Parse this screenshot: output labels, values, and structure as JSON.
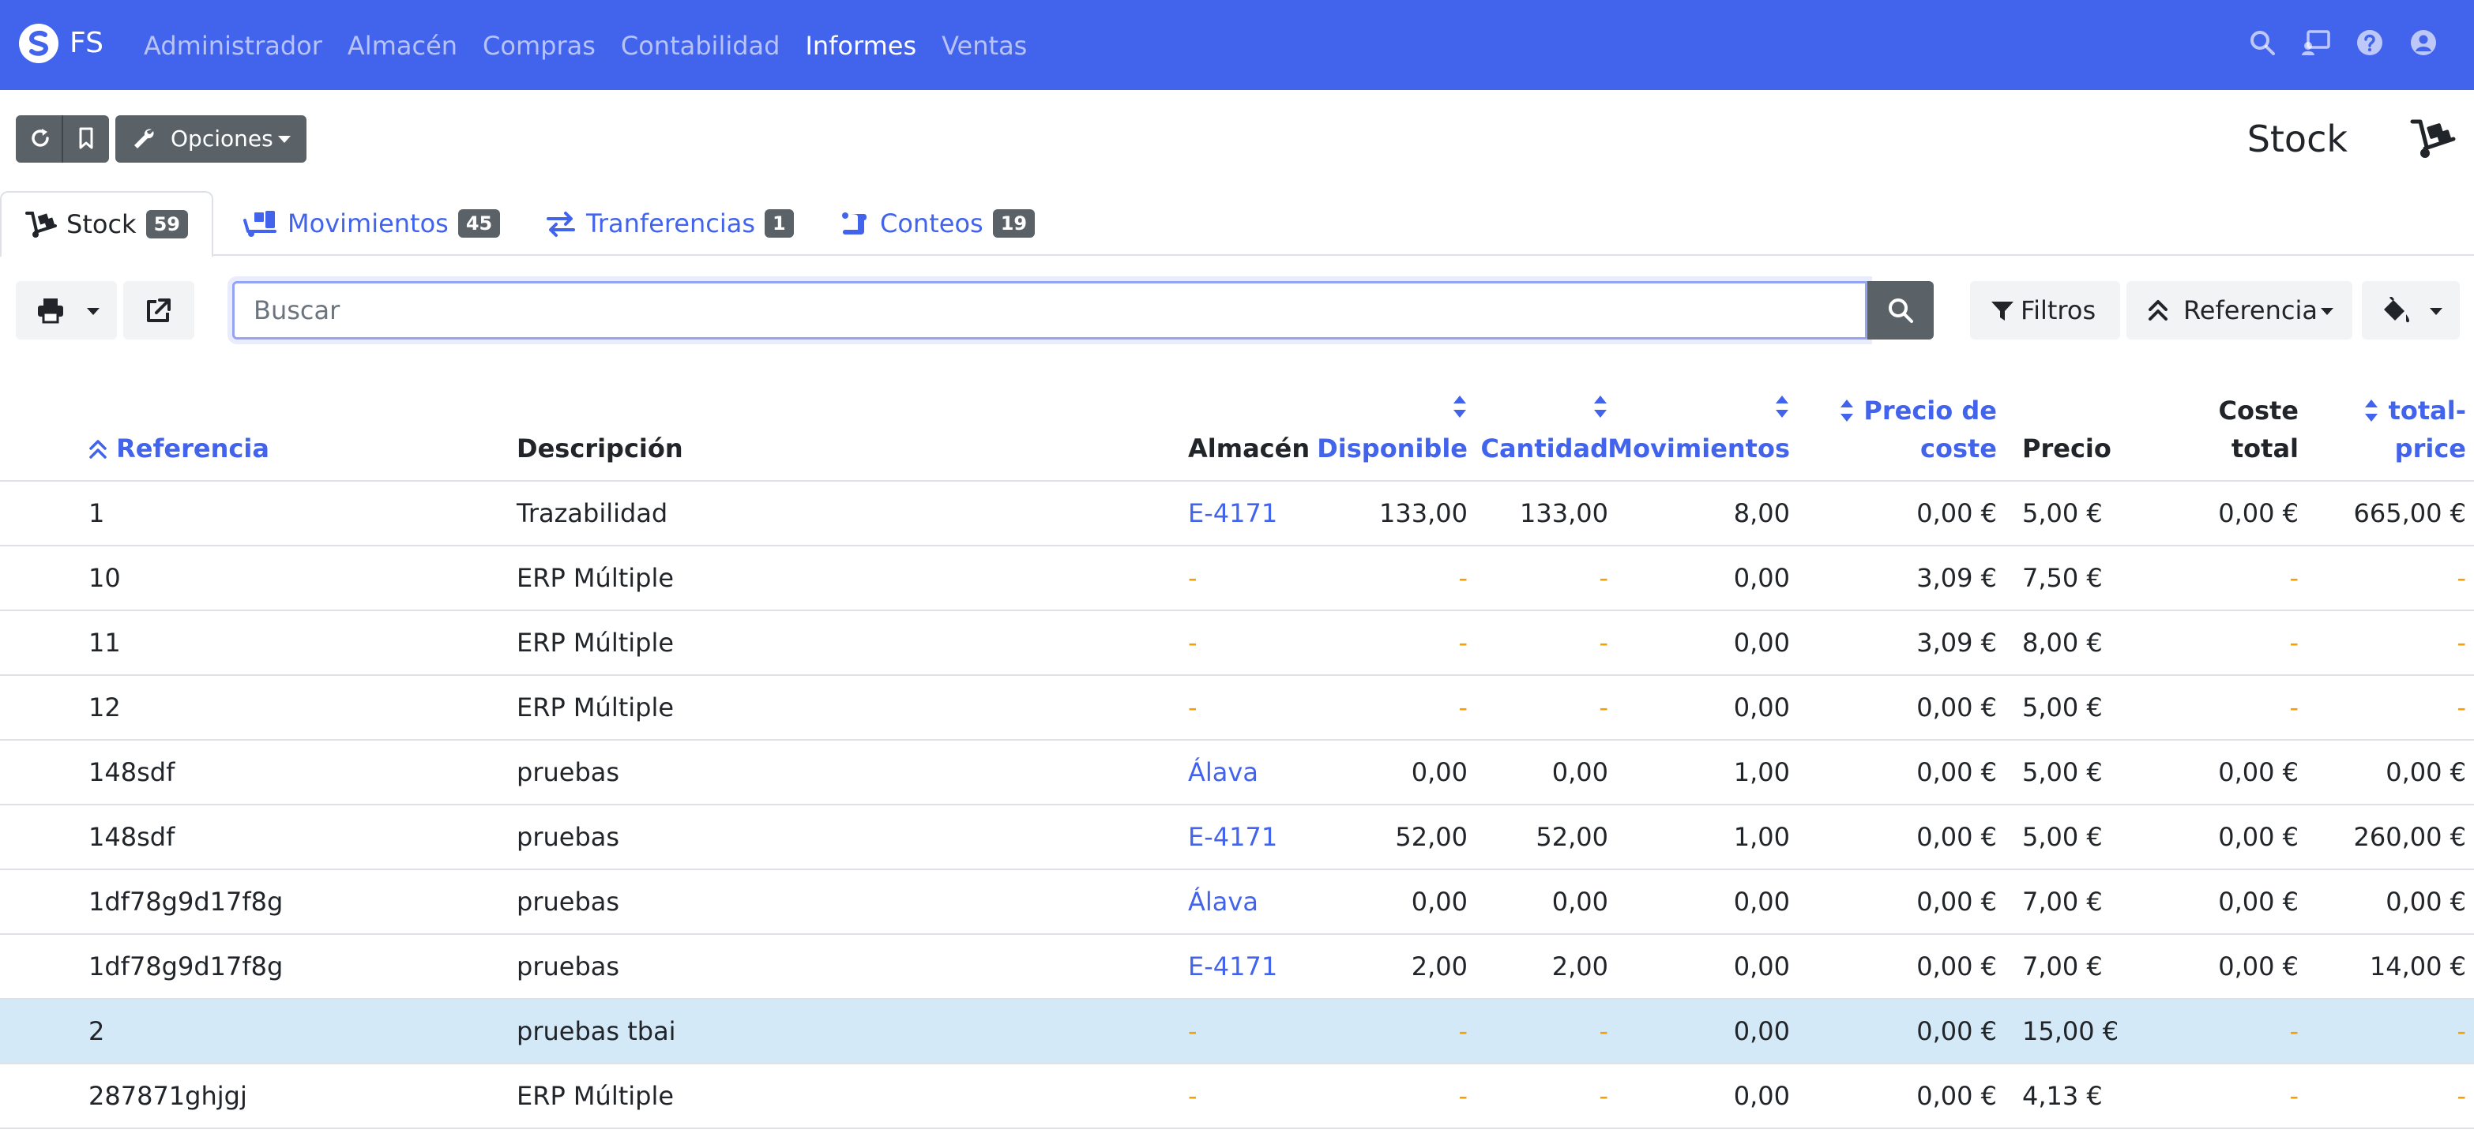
{
  "navbar": {
    "brand": "FS",
    "links": [
      "Administrador",
      "Almacén",
      "Compras",
      "Contabilidad",
      "Informes",
      "Ventas"
    ],
    "active_link": "Informes",
    "icons": [
      "search-icon",
      "tv-user-icon",
      "question-icon",
      "user-circle-icon"
    ]
  },
  "toolbar": {
    "options_label": "Opciones",
    "page_title": "Stock"
  },
  "tabs": [
    {
      "label": "Stock",
      "count": "59",
      "icon": "dolly-icon"
    },
    {
      "label": "Movimientos",
      "count": "45",
      "icon": "truck-loading-icon"
    },
    {
      "label": "Tranferencias",
      "count": "1",
      "icon": "exchange-icon"
    },
    {
      "label": "Conteos",
      "count": "19",
      "icon": "scroll-icon"
    }
  ],
  "search": {
    "placeholder": "Buscar",
    "value": "",
    "filters_label": "Filtros",
    "order_label": "Referencia"
  },
  "table": {
    "headers": {
      "referencia": "Referencia",
      "descripcion": "Descripción",
      "almacen": "Almacén",
      "disponible": "Disponible",
      "cantidad": "Cantidad",
      "movimientos": "Movimientos",
      "precio_coste_1": "Precio de",
      "precio_coste_2": "coste",
      "precio": "Precio",
      "coste_total_1": "Coste",
      "coste_total_2": "total",
      "total_price_1": "total-",
      "total_price_2": "price"
    },
    "rows": [
      {
        "ref": "1",
        "desc": "Trazabilidad",
        "almacen": "E-4171",
        "disponible": "133,00",
        "cantidad": "133,00",
        "movimientos": "8,00",
        "coste": "0,00 €",
        "precio": "5,00 €",
        "coste_total": "0,00 €",
        "total_price": "665,00 €"
      },
      {
        "ref": "10",
        "desc": "ERP Múltiple",
        "almacen": "-",
        "disponible": "-",
        "cantidad": "-",
        "movimientos": "0,00",
        "coste": "3,09 €",
        "precio": "7,50 €",
        "coste_total": "-",
        "total_price": "-"
      },
      {
        "ref": "11",
        "desc": "ERP Múltiple",
        "almacen": "-",
        "disponible": "-",
        "cantidad": "-",
        "movimientos": "0,00",
        "coste": "3,09 €",
        "precio": "8,00 €",
        "coste_total": "-",
        "total_price": "-"
      },
      {
        "ref": "12",
        "desc": "ERP Múltiple",
        "almacen": "-",
        "disponible": "-",
        "cantidad": "-",
        "movimientos": "0,00",
        "coste": "0,00 €",
        "precio": "5,00 €",
        "coste_total": "-",
        "total_price": "-"
      },
      {
        "ref": "148sdf",
        "desc": "pruebas",
        "almacen": "Álava",
        "disponible": "0,00",
        "cantidad": "0,00",
        "movimientos": "1,00",
        "coste": "0,00 €",
        "precio": "5,00 €",
        "coste_total": "0,00 €",
        "total_price": "0,00 €"
      },
      {
        "ref": "148sdf",
        "desc": "pruebas",
        "almacen": "E-4171",
        "disponible": "52,00",
        "cantidad": "52,00",
        "movimientos": "1,00",
        "coste": "0,00 €",
        "precio": "5,00 €",
        "coste_total": "0,00 €",
        "total_price": "260,00 €"
      },
      {
        "ref": "1df78g9d17f8g",
        "desc": "pruebas",
        "almacen": "Álava",
        "disponible": "0,00",
        "cantidad": "0,00",
        "movimientos": "0,00",
        "coste": "0,00 €",
        "precio": "7,00 €",
        "coste_total": "0,00 €",
        "total_price": "0,00 €"
      },
      {
        "ref": "1df78g9d17f8g",
        "desc": "pruebas",
        "almacen": "E-4171",
        "disponible": "2,00",
        "cantidad": "2,00",
        "movimientos": "0,00",
        "coste": "0,00 €",
        "precio": "7,00 €",
        "coste_total": "0,00 €",
        "total_price": "14,00 €"
      },
      {
        "ref": "2",
        "desc": "pruebas tbai",
        "almacen": "-",
        "disponible": "-",
        "cantidad": "-",
        "movimientos": "0,00",
        "coste": "0,00 €",
        "precio": "15,00 €",
        "coste_total": "-",
        "total_price": "-",
        "selected": true
      },
      {
        "ref": "287871ghjgj",
        "desc": "ERP Múltiple",
        "almacen": "-",
        "disponible": "-",
        "cantidad": "-",
        "movimientos": "0,00",
        "coste": "0,00 €",
        "precio": "4,13 €",
        "coste_total": "-",
        "total_price": "-"
      }
    ]
  },
  "colors": {
    "navbar": "#4263eb",
    "link": "#4263eb",
    "empty_dash": "#f59f00",
    "selected_row": "#d4e9f7",
    "dark_button": "#5a6268"
  }
}
